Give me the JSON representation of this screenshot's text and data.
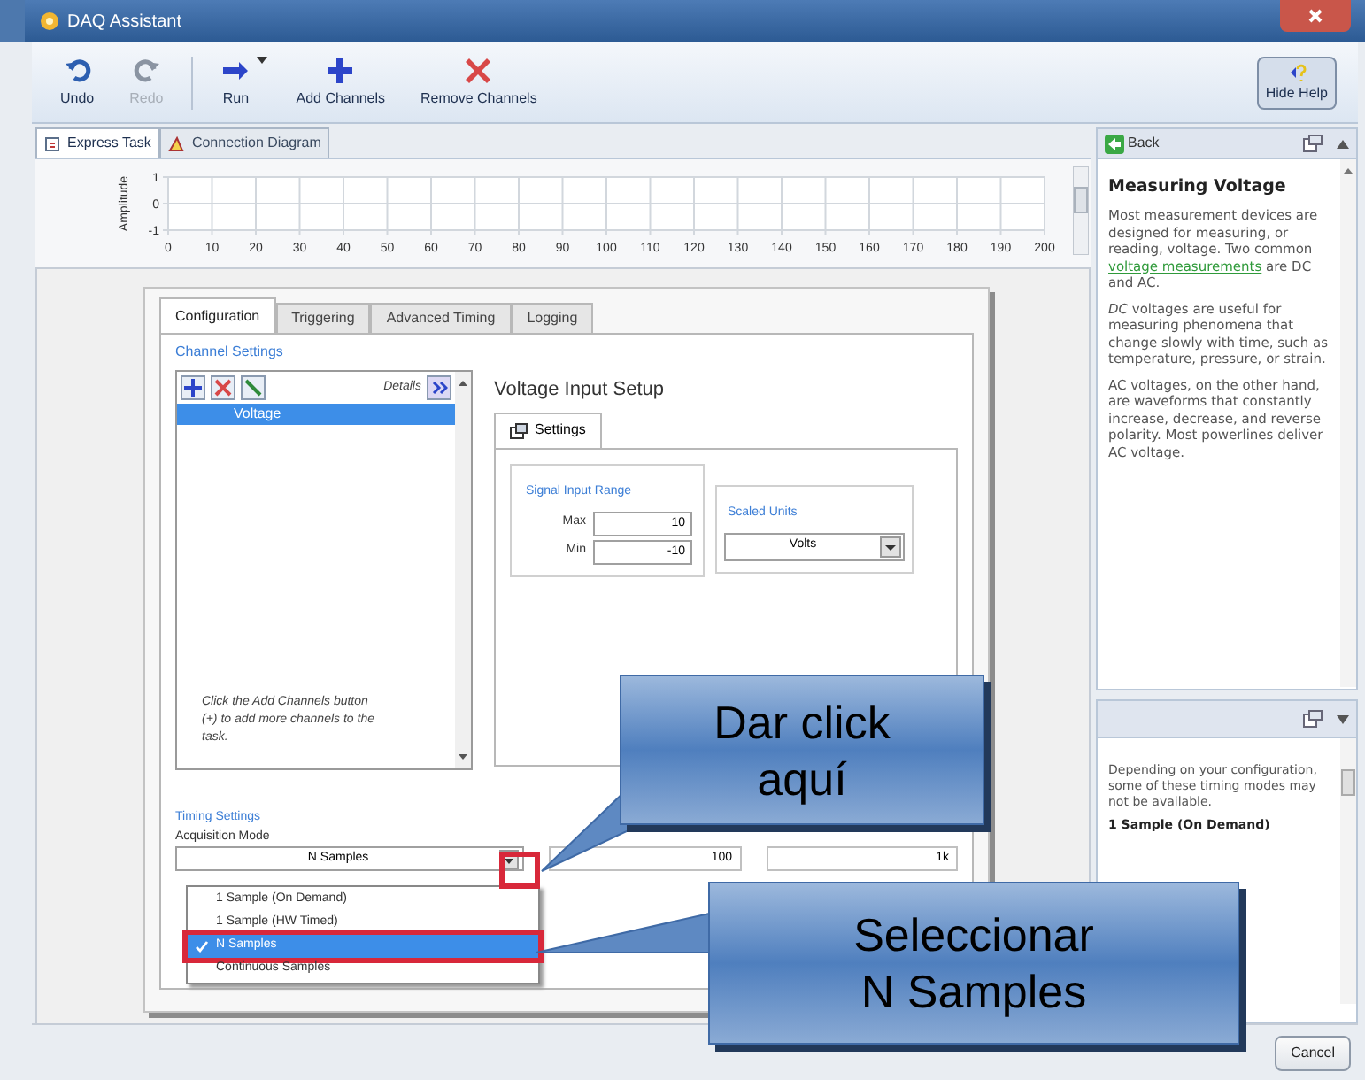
{
  "window": {
    "title": "DAQ Assistant"
  },
  "toolbar": [
    {
      "label": "Undo",
      "kind": "undo",
      "disabled": false
    },
    {
      "label": "Redo",
      "kind": "redo",
      "disabled": true
    },
    {
      "label": "Run",
      "kind": "run",
      "disabled": false
    },
    {
      "label": "Add Channels",
      "kind": "add",
      "disabled": false
    },
    {
      "label": "Remove Channels",
      "kind": "remove",
      "disabled": false
    }
  ],
  "hide_help": "Hide Help",
  "view_tabs": [
    {
      "label": "Express Task",
      "selected": true
    },
    {
      "label": "Connection Diagram",
      "selected": false
    }
  ],
  "graph": {
    "chart_data": {
      "type": "line",
      "grid": true,
      "ylabel": "Amplitude",
      "xlim": [
        0,
        200
      ],
      "ylim": [
        -1,
        1
      ],
      "xticks": [
        0,
        10,
        20,
        30,
        40,
        50,
        60,
        70,
        80,
        90,
        100,
        110,
        120,
        130,
        140,
        150,
        160,
        170,
        180,
        190,
        200
      ],
      "yticks": [
        -1,
        0,
        1
      ]
    }
  },
  "config_tabs": [
    {
      "label": "Configuration",
      "selected": true
    },
    {
      "label": "Triggering",
      "selected": false
    },
    {
      "label": "Advanced Timing",
      "selected": false
    },
    {
      "label": "Logging",
      "selected": false
    }
  ],
  "channel_settings": {
    "title": "Channel Settings",
    "details": "Details",
    "channels": [
      {
        "name": "Voltage",
        "selected": true
      }
    ],
    "hint": "Click the Add Channels button (+) to add more channels to the task."
  },
  "voltage_setup": {
    "title": "Voltage Input Setup",
    "tab": "Settings",
    "range_title": "Signal Input Range",
    "max_label": "Max",
    "max": "10",
    "min_label": "Min",
    "min": "-10",
    "units_title": "Scaled Units",
    "units": "Volts"
  },
  "timing": {
    "title": "Timing Settings",
    "mode_label": "Acquisition Mode",
    "mode": "N Samples",
    "fields": [
      "100",
      "1k"
    ],
    "options": [
      {
        "label": "1 Sample (On Demand)",
        "selected": false
      },
      {
        "label": "1 Sample (HW Timed)",
        "selected": false
      },
      {
        "label": "N Samples",
        "selected": true
      },
      {
        "label": "Continuous Samples",
        "selected": false
      }
    ]
  },
  "help": {
    "back": "Back",
    "title": "Measuring Voltage",
    "intro": "Most measurement devices are designed for measuring, or reading, voltage. Two common",
    "link": "voltage measurements",
    "intro_end": "are DC and AC.",
    "paragraphs": [
      "*DC* voltages are useful for measuring phenomena that change slowly with time, such as temperature, pressure, or strain.",
      "AC voltages, on the other hand, are waveforms that constantly increase, decrease, and reverse polarity. Most powerlines deliver AC voltage."
    ]
  },
  "help_timing": {
    "text": "Depending on your configuration, some of these timing modes may not be available.",
    "heading": "1 Sample (On Demand)"
  },
  "cancel": "Cancel",
  "callouts": [
    {
      "lines": [
        "Dar click",
        "aquí"
      ]
    },
    {
      "lines": [
        "Seleccionar",
        "N Samples"
      ]
    }
  ]
}
